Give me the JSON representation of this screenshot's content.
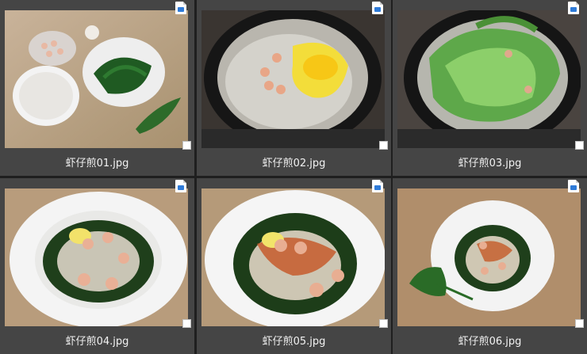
{
  "files": [
    {
      "name": "虾仔煎01.jpg",
      "scene": "ingredients"
    },
    {
      "name": "虾仔煎02.jpg",
      "scene": "pan-egg"
    },
    {
      "name": "虾仔煎03.jpg",
      "scene": "pan-greens"
    },
    {
      "name": "虾仔煎04.jpg",
      "scene": "plate"
    },
    {
      "name": "虾仔煎05.jpg",
      "scene": "plate-sauce"
    },
    {
      "name": "虾仔煎06.jpg",
      "scene": "plate-far"
    }
  ],
  "colors": {
    "background": "#1f1f1f",
    "tile": "#454545",
    "label": "#f2f2f2",
    "badge_accent": "#2f7bd8"
  }
}
